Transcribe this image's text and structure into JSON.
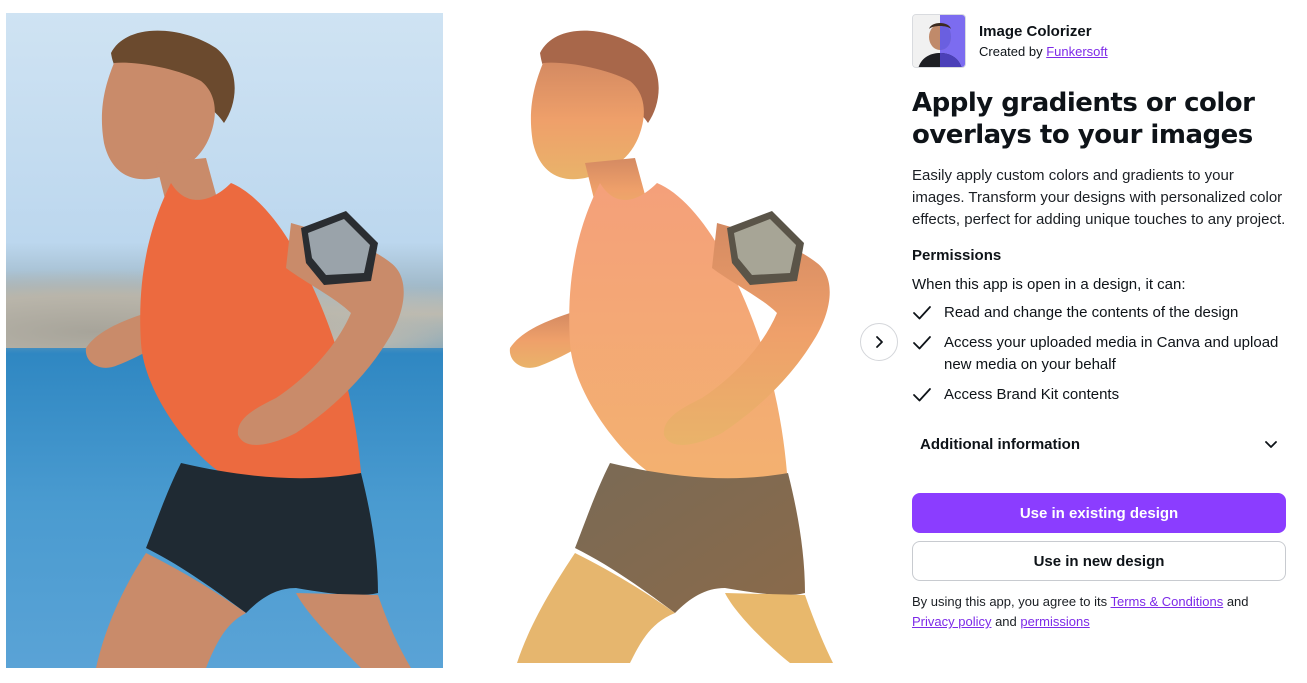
{
  "app": {
    "name": "Image Colorizer",
    "created_by_prefix": "Created by ",
    "creator": "Funkersoft"
  },
  "headline": "Apply gradients or color overlays to your images",
  "description": "Easily apply custom colors and gradients to your images. Transform your designs with personalized color effects, perfect for adding unique touches to any project.",
  "permissions": {
    "title": "Permissions",
    "intro": "When this app is open in a design, it can:",
    "items": [
      "Read and change the contents of the design",
      "Access your uploaded media in Canva and upload new media on your behalf",
      "Access Brand Kit contents"
    ]
  },
  "additional_info_label": "Additional information",
  "buttons": {
    "existing": "Use in existing design",
    "new": "Use in new design"
  },
  "legal": {
    "prefix": "By using this app, you agree to its ",
    "terms": "Terms & Conditions",
    "and1": " and",
    "privacy": "Privacy policy",
    "and2": " and ",
    "permissions": "permissions"
  },
  "icons": {
    "next": "chevron-right-icon",
    "expand": "chevron-down-icon",
    "check": "check-icon"
  },
  "colors": {
    "accent": "#8b3dff",
    "link": "#7d2ae8"
  }
}
